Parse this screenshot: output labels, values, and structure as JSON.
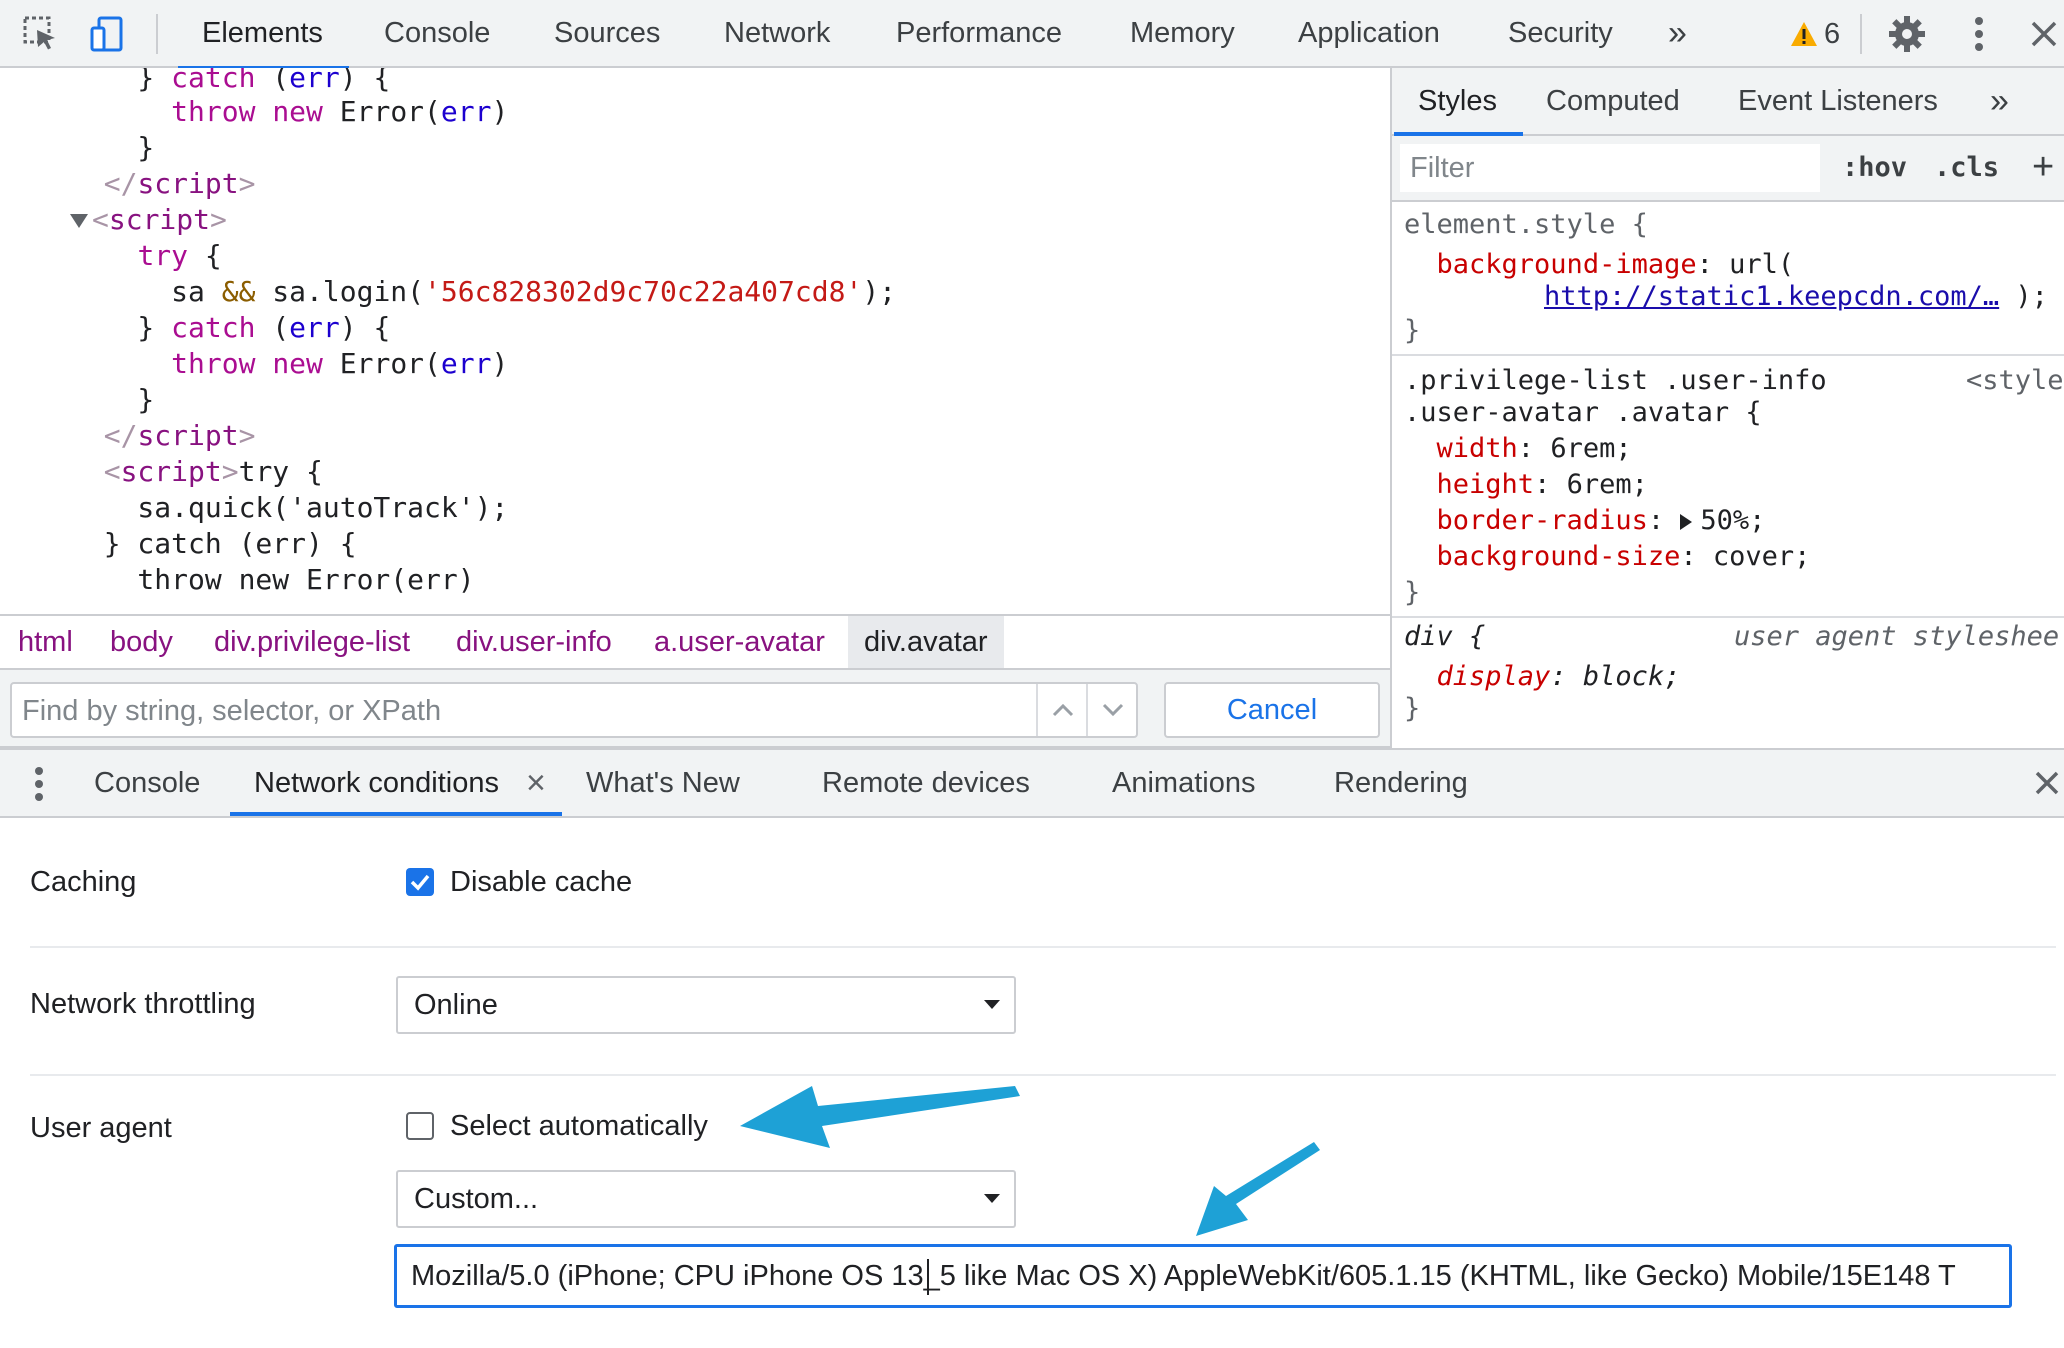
{
  "toolbar": {
    "tabs": [
      "Elements",
      "Console",
      "Sources",
      "Network",
      "Performance",
      "Memory",
      "Application",
      "Security"
    ],
    "more_label": "»",
    "warning_count": "6"
  },
  "elements": {
    "lines": [
      {
        "parts": [
          [
            "",
            "    } "
          ],
          [
            "kw",
            "catch"
          ],
          [
            "",
            " ("
          ],
          [
            "var",
            "err"
          ],
          [
            "",
            ") {"
          ]
        ]
      },
      {
        "parts": [
          [
            "",
            "      "
          ],
          [
            "kw",
            "throw"
          ],
          [
            "",
            " "
          ],
          [
            "kw",
            "new"
          ],
          [
            "",
            " Error("
          ],
          [
            "var",
            "err"
          ],
          [
            "",
            ")"
          ]
        ]
      },
      {
        "parts": [
          [
            "",
            "    }"
          ]
        ]
      },
      {
        "parts": [
          [
            "",
            "  "
          ],
          [
            "tagb",
            "</"
          ],
          [
            "tag",
            "script"
          ],
          [
            "tagb",
            ">"
          ]
        ]
      },
      {
        "parts": [
          [
            "tri",
            ""
          ],
          [
            "tagb",
            "<"
          ],
          [
            "tag",
            "script"
          ],
          [
            "tagb",
            ">"
          ]
        ]
      },
      {
        "parts": [
          [
            "",
            "    "
          ],
          [
            "kw",
            "try"
          ],
          [
            "",
            " {"
          ]
        ]
      },
      {
        "parts": [
          [
            "",
            "      sa "
          ],
          [
            "op",
            "&&"
          ],
          [
            "",
            " sa.login("
          ],
          [
            "str",
            "'56c828302d9c70c22a407cd8'"
          ],
          [
            "",
            ");"
          ]
        ]
      },
      {
        "parts": [
          [
            "",
            "    } "
          ],
          [
            "kw",
            "catch"
          ],
          [
            "",
            " ("
          ],
          [
            "var",
            "err"
          ],
          [
            "",
            ") {"
          ]
        ]
      },
      {
        "parts": [
          [
            "",
            "      "
          ],
          [
            "kw",
            "throw"
          ],
          [
            "",
            " "
          ],
          [
            "kw",
            "new"
          ],
          [
            "",
            " Error("
          ],
          [
            "var",
            "err"
          ],
          [
            "",
            ")"
          ]
        ]
      },
      {
        "parts": [
          [
            "",
            "    }"
          ]
        ]
      },
      {
        "parts": [
          [
            "",
            "  "
          ],
          [
            "tagb",
            "</"
          ],
          [
            "tag",
            "script"
          ],
          [
            "tagb",
            ">"
          ]
        ]
      },
      {
        "parts": [
          [
            "",
            "  "
          ],
          [
            "tagb",
            "<"
          ],
          [
            "tag",
            "script"
          ],
          [
            "tagb",
            ">"
          ],
          [
            "",
            "try {"
          ]
        ]
      },
      {
        "parts": [
          [
            "",
            "    sa.quick('autoTrack');"
          ]
        ]
      },
      {
        "parts": [
          [
            "",
            "  } catch (err) {"
          ]
        ]
      },
      {
        "parts": [
          [
            "",
            "    throw new Error(err)"
          ]
        ]
      }
    ],
    "breadcrumbs": [
      "html",
      "body",
      "div.privilege-list",
      "div.user-info",
      "a.user-avatar",
      "div.avatar"
    ],
    "find_placeholder": "Find by string, selector, or XPath",
    "cancel_label": "Cancel"
  },
  "styles": {
    "tabs": [
      "Styles",
      "Computed",
      "Event Listeners"
    ],
    "more_label": "»",
    "filter_placeholder": "Filter",
    "hov_label": ":hov",
    "cls_label": ".cls",
    "add_label": "+",
    "element_style_selector": "element.style {",
    "bg_image_prop": "background-image",
    "bg_image_fn": "url(",
    "bg_image_url": "http://static1.keepcdn.com/…",
    "bg_image_end": ");",
    "close_brace": "}",
    "rule2_selector_1": ".privilege-list .user-info",
    "rule2_selector_2": ".user-avatar .avatar {",
    "rule2_source": "<style",
    "rule2_props": [
      {
        "name": "width",
        "value": "6rem;"
      },
      {
        "name": "height",
        "value": "6rem;"
      },
      {
        "name": "border-radius",
        "value": "50%;"
      },
      {
        "name": "background-size",
        "value": "cover;"
      }
    ],
    "rule3_selector": "div {",
    "rule3_source": "user agent styleshee",
    "rule3_prop": "display",
    "rule3_value": "block;"
  },
  "drawer": {
    "tabs": [
      "Console",
      "Network conditions",
      "What's New",
      "Remote devices",
      "Animations",
      "Rendering"
    ],
    "tab_close": "×"
  },
  "network_conditions": {
    "caching_label": "Caching",
    "disable_cache_label": "Disable cache",
    "disable_cache_checked": true,
    "throttling_label": "Network throttling",
    "throttling_value": "Online",
    "ua_label": "User agent",
    "select_auto_label": "Select automatically",
    "select_auto_checked": false,
    "ua_select_value": "Custom...",
    "ua_string": "Mozilla/5.0 (iPhone; CPU iPhone OS 13_5 like Mac OS X) AppleWebKit/605.1.15 (KHTML, like Gecko) Mobile/15E148 T"
  },
  "colors": {
    "accent": "#1a73e8",
    "annotation_arrow": "#1ea1d6",
    "warning": "#f9ab00"
  }
}
